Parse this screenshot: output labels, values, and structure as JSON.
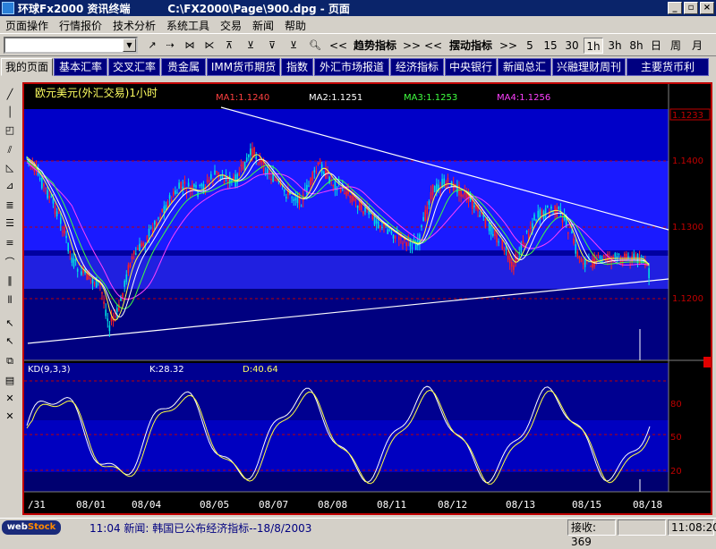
{
  "window": {
    "app_title": "环球Fx2000 资讯终端",
    "doc_title": "C:\\FX2000\\Page\\900.dpg - 页面",
    "minimize": "_",
    "restore": "▫",
    "close": "×"
  },
  "menu": [
    "页面操作",
    "行情报价",
    "技术分析",
    "系统工具",
    "交易",
    "新闻",
    "帮助"
  ],
  "toolbar": {
    "combo_value": "",
    "trend_label": "趋势指标",
    "osc_label": "摆动指标",
    "prev_label": "<<",
    "next_label": ">>",
    "periods": [
      "5",
      "15",
      "30",
      "1h",
      "3h",
      "8h",
      "日",
      "周",
      "月"
    ],
    "selected_period": "1h"
  },
  "tabs": [
    "我的页面",
    "基本汇率",
    "交叉汇率",
    "贵金属",
    "IMM货币期货",
    "指数",
    "外汇市场报道",
    "经济指标",
    "中央银行",
    "新闻总汇",
    "兴融理财周刊",
    "主要货币利"
  ],
  "chart": {
    "instrument": "欧元美元(外汇交易)1小时",
    "ma_labels": [
      {
        "text": "MA1:1.1240",
        "color": "#ff4040"
      },
      {
        "text": "MA2:1.1251",
        "color": "#ffffff"
      },
      {
        "text": "MA3:1.1253",
        "color": "#40ff40"
      },
      {
        "text": "MA4:1.1256",
        "color": "#ff40ff"
      }
    ],
    "price_labels": [
      "1.1233",
      "1.1400",
      "1.1300",
      "1.1200"
    ],
    "kd_title": "KD(9,3,3)",
    "kd_k": "K:28.32",
    "kd_d": "D:40.64",
    "kd_levels": [
      "80",
      "50",
      "20"
    ],
    "dates": [
      "/31",
      "08/01",
      "08/04",
      "08/05",
      "08/07",
      "08/08",
      "08/11",
      "08/12",
      "08/13",
      "08/15",
      "08/18"
    ]
  },
  "status": {
    "logo_a": "web",
    "logo_b": "Stock",
    "news": "11:04 新闻: 韩国已公布经济指标--18/8/2003",
    "received": "接收: 369",
    "clock": "11:08:20"
  }
}
